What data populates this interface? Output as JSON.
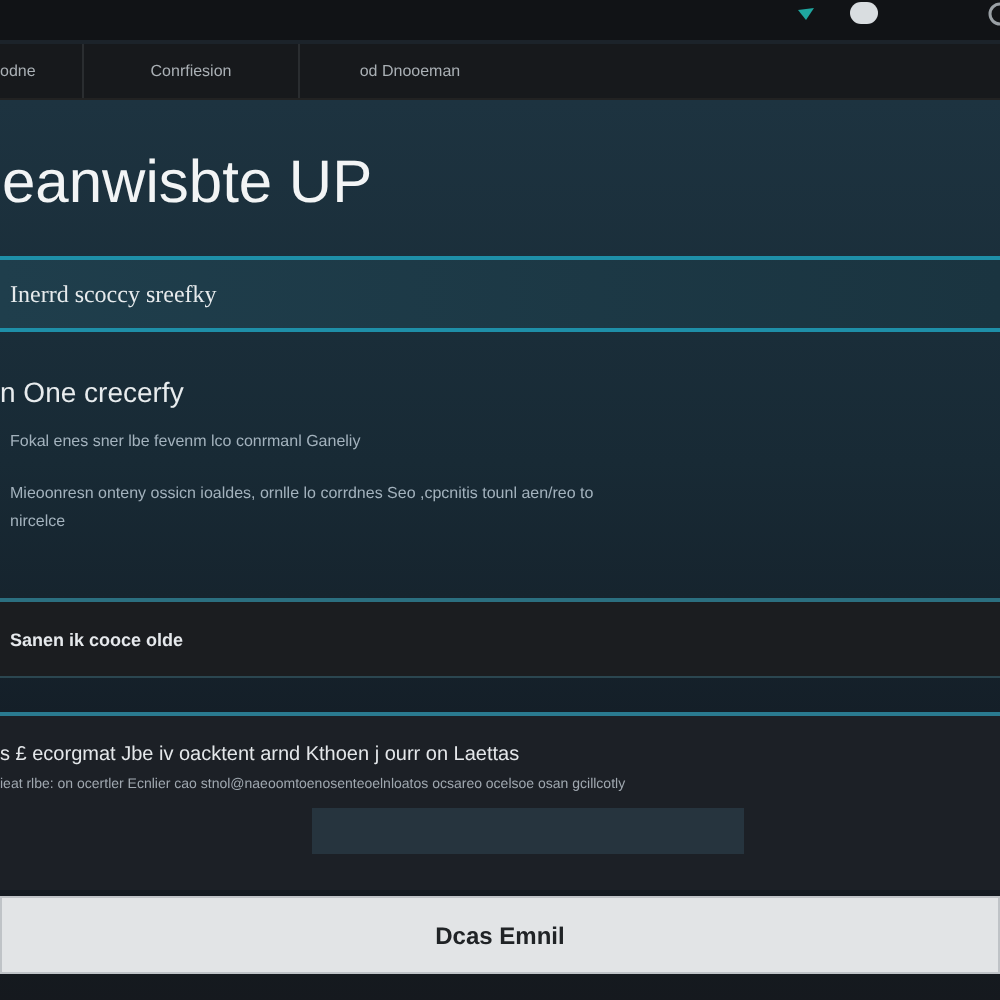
{
  "nav": {
    "tabs": [
      {
        "label": "odne",
        "selected": false
      },
      {
        "label": "Conrfiesion",
        "selected": false
      },
      {
        "label": "od Dnooeman",
        "selected": false
      }
    ]
  },
  "hero": {
    "title": "eanwisbte UP"
  },
  "highlight": {
    "text": "Inerrd scoccy sreefky"
  },
  "section": {
    "heading": "n One crecerfy",
    "paragraphs": [
      "Fokal enes sner lbe fevenm lco conrmanl Ganeliy",
      "Mieoonresn onteny ossicn ioaldes, ornlle lo corrdnes Seo ,cpcnitis tounl aen/reo to nircelce"
    ]
  },
  "banner": {
    "text": "Sanen ik cooce olde"
  },
  "panel": {
    "heading": "s £ ecorgmat Jbe iv oacktent arnd Kthoen j ourr on Laettas",
    "detail": "ieat rlbe: on ocertler Ecnlier cao stnol@naeoomtoenosenteoelnloatos ocsareo ocelsoe osan gcillcotly"
  },
  "button": {
    "label": "Dcas Emnil"
  }
}
